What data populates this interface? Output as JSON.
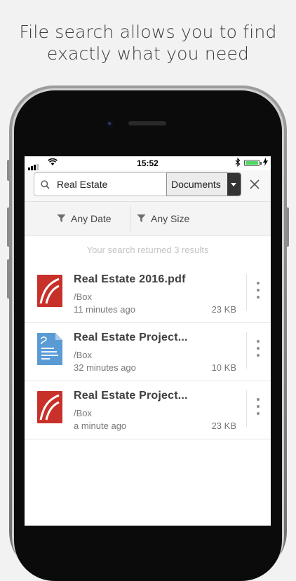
{
  "headline": {
    "line1": "File search allows you to find",
    "line2": "exactly what you need"
  },
  "statusbar": {
    "time": "15:52"
  },
  "search": {
    "query": "Real Estate",
    "scope": "Documents"
  },
  "filters": {
    "date": "Any Date",
    "size": "Any Size"
  },
  "summary": "Your search returned 3 results",
  "results": [
    {
      "name": "Real Estate 2016.pdf",
      "path": "/Box",
      "modified": "11 minutes ago",
      "size": "23 KB",
      "icon": "pdf-file-icon"
    },
    {
      "name": "Real Estate Project...",
      "path": "/Box",
      "modified": "32 minutes ago",
      "size": "10 KB",
      "icon": "document-file-icon"
    },
    {
      "name": "Real Estate Project...",
      "path": "/Box",
      "modified": "a minute ago",
      "size": "23 KB",
      "icon": "pdf-file-icon"
    }
  ],
  "colors": {
    "pdf_red": "#c8312a",
    "doc_blue": "#5b9bd5",
    "battery_green": "#4cd964"
  }
}
